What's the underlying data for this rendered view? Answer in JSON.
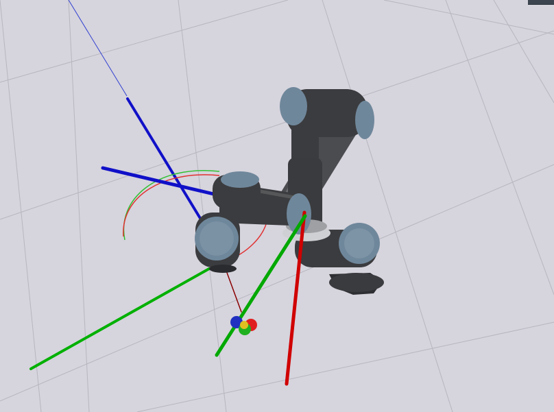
{
  "scene": {
    "background": "#d6d4dd",
    "grid_color": "#b7b6bf",
    "robot": {
      "link_color": "#3b3c3f",
      "link_highlight": "#5a5b5f",
      "joint_cap_color": "#6f879b",
      "joint_cap_dark": "#4f6475"
    },
    "axis_colors": {
      "x": "#e00000",
      "y": "#00c000",
      "z": "#1010d0"
    },
    "interactive_marker_colors": {
      "ring_red": "#e03030",
      "ring_green": "#30c030"
    }
  }
}
